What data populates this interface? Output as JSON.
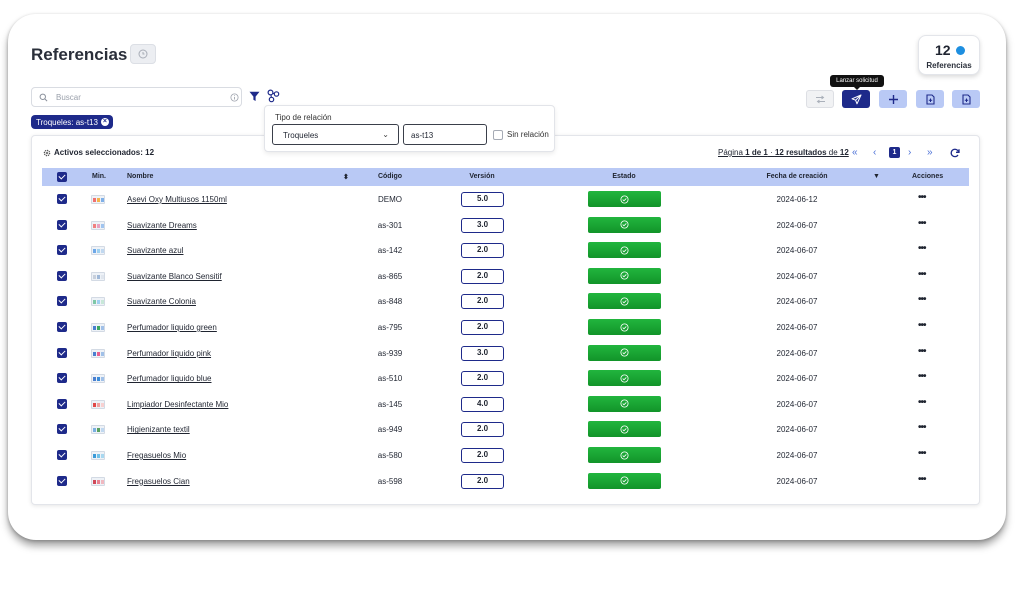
{
  "header": {
    "title": "Referencias",
    "count": "12",
    "count_label": "Referencias"
  },
  "search": {
    "placeholder": "Buscar"
  },
  "filter_chip": {
    "label": "Troqueles: as-t13"
  },
  "relation_popover": {
    "label": "Tipo de relación",
    "selected": "Troqueles",
    "input_value": "as-t13",
    "checkbox_label": "Sin relación"
  },
  "tooltip": "Lanzar solicitud",
  "table": {
    "active_selected": "Activos seleccionados: 12",
    "pager": {
      "prefix": "Página",
      "range": "1 de 1",
      "sep": " · ",
      "results": "12 resultados",
      "of": " de ",
      "total": "12",
      "current_page": "1"
    },
    "columns": [
      "Min.",
      "Nombre",
      "Código",
      "Versión",
      "Estado",
      "Fecha de creación",
      "Acciones"
    ],
    "rows": [
      {
        "name": "Asevi Oxy Multiusos 1150ml",
        "code": "DEMO",
        "version": "5.0",
        "date": "2024-06-12",
        "thumb": [
          "#f07070",
          "#f4b24c",
          "#7fb0e8"
        ]
      },
      {
        "name": "Suavizante Dreams",
        "code": "as-301",
        "version": "3.0",
        "date": "2024-06-07",
        "thumb": [
          "#f08080",
          "#e8a0c0",
          "#a0c4ef"
        ]
      },
      {
        "name": "Suavizante azul",
        "code": "as-142",
        "version": "2.0",
        "date": "2024-06-07",
        "thumb": [
          "#6ea8e8",
          "#9fd0f0",
          "#c0d8f0"
        ]
      },
      {
        "name": "Suavizante Blanco Sensitif",
        "code": "as-865",
        "version": "2.0",
        "date": "2024-06-07",
        "thumb": [
          "#c8d0dc",
          "#9fb8d8",
          "#e0e6ee"
        ]
      },
      {
        "name": "Suavizante Colonia",
        "code": "as-848",
        "version": "2.0",
        "date": "2024-06-07",
        "thumb": [
          "#7ec8a8",
          "#9fd0f0",
          "#c8e8d8"
        ]
      },
      {
        "name": "Perfumador liquido green",
        "code": "as-795",
        "version": "2.0",
        "date": "2024-06-07",
        "thumb": [
          "#4a7fd0",
          "#3aa860",
          "#a0c0e8"
        ]
      },
      {
        "name": "Perfumador liquido pink",
        "code": "as-939",
        "version": "3.0",
        "date": "2024-06-07",
        "thumb": [
          "#4a7fd0",
          "#e86090",
          "#a0c0e8"
        ]
      },
      {
        "name": "Perfumador liquido blue",
        "code": "as-510",
        "version": "2.0",
        "date": "2024-06-07",
        "thumb": [
          "#4a7fd0",
          "#3a8ad8",
          "#a0c0e8"
        ]
      },
      {
        "name": "Limpiador Desinfectante Mio",
        "code": "as-145",
        "version": "4.0",
        "date": "2024-06-07",
        "thumb": [
          "#e04848",
          "#f0a0a0",
          "#f8d0d0"
        ]
      },
      {
        "name": "Higienizante textil",
        "code": "as-949",
        "version": "2.0",
        "date": "2024-06-07",
        "thumb": [
          "#7ab0e0",
          "#58a060",
          "#c0d8f0"
        ]
      },
      {
        "name": "Fregasuelos Mio",
        "code": "as-580",
        "version": "2.0",
        "date": "2024-06-07",
        "thumb": [
          "#3a9ad8",
          "#70c0e8",
          "#a8d8f0"
        ]
      },
      {
        "name": "Fregasuelos Cian",
        "code": "as-598",
        "version": "2.0",
        "date": "2024-06-07",
        "thumb": [
          "#d04858",
          "#e88090",
          "#f0b8c0"
        ]
      }
    ]
  },
  "colors": {
    "primary": "#1e2a8a",
    "light_blue": "#b9c9f5",
    "success": "#22b53e",
    "accent_dot": "#1e8fe0"
  },
  "icons": [
    "clock-icon",
    "search-icon",
    "info-icon",
    "filter-icon",
    "relation-icon",
    "close-icon",
    "shuffle-icon",
    "send-icon",
    "plus-icon",
    "document-plus-icon",
    "gear-icon",
    "double-chevron-left-icon",
    "chevron-left-icon",
    "chevron-right-icon",
    "double-chevron-right-icon",
    "refresh-icon",
    "sort-icon",
    "check-circle-icon",
    "more-icon"
  ]
}
